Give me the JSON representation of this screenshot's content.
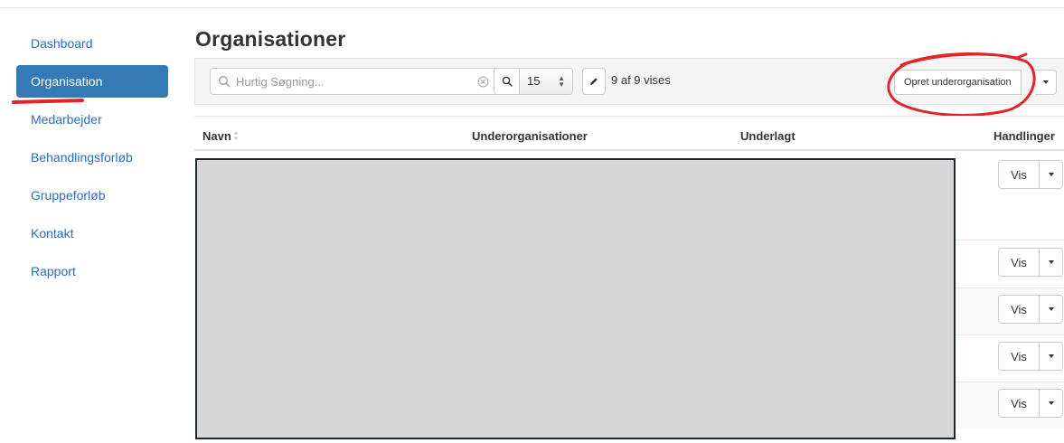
{
  "sidebar": {
    "items": [
      {
        "label": "Dashboard",
        "active": false
      },
      {
        "label": "Organisation",
        "active": true
      },
      {
        "label": "Medarbejder",
        "active": false
      },
      {
        "label": "Behandlingsforløb",
        "active": false
      },
      {
        "label": "Gruppeforløb",
        "active": false
      },
      {
        "label": "Kontakt",
        "active": false
      },
      {
        "label": "Rapport",
        "active": false
      }
    ]
  },
  "page": {
    "title": "Organisationer"
  },
  "toolbar": {
    "search_placeholder": "Hurtig Søgning...",
    "page_size": "15",
    "count_text": "9 af 9 vises",
    "create_label": "Opret underorganisation"
  },
  "table": {
    "headers": [
      "Navn",
      "Underorganisationer",
      "Underlagt",
      "Handlinger"
    ],
    "row_action_label": "Vis",
    "rows_visible": 5
  },
  "colors": {
    "accent": "#337ab7",
    "link": "#2a6ebb",
    "annotation": "#e0252b",
    "redaction": "#d6d6d6"
  }
}
